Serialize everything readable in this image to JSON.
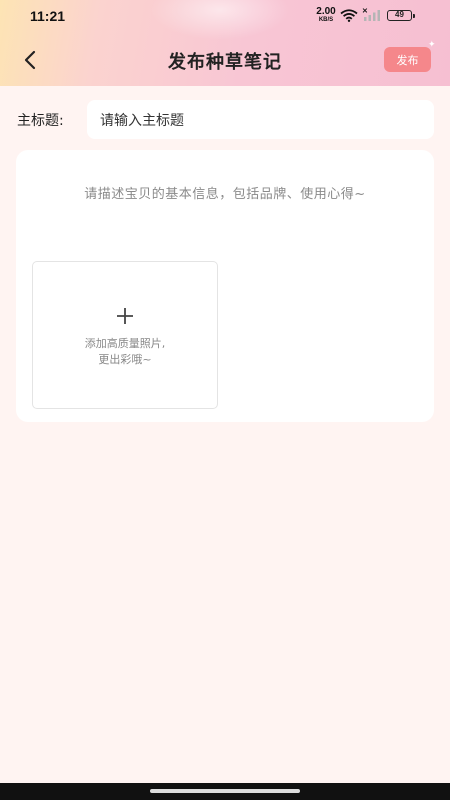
{
  "status_bar": {
    "time": "11:21",
    "net_speed_value": "2.00",
    "net_speed_unit": "KB/S",
    "sim_mark": "✕",
    "battery": "49"
  },
  "nav": {
    "title": "发布种草笔记",
    "publish_label": "发布",
    "sparkle": "✦"
  },
  "form": {
    "title_label": "主标题:",
    "title_placeholder": "请输入主标题",
    "description_placeholder": "请描述宝贝的基本信息，包括品牌、使用心得~",
    "photo_hint_line1": "添加高质量照片,",
    "photo_hint_line2": "更出彩哦~"
  },
  "colors": {
    "accent": "#f5878b",
    "page_background": "#fff4f2",
    "header_gradient_start": "#fde4b4",
    "header_gradient_end": "#f6bfd2"
  },
  "icons": {
    "back": "back-arrow-icon",
    "add_photo": "plus-icon",
    "wifi": "wifi-icon",
    "signal": "signal-icon",
    "battery": "battery-icon"
  }
}
